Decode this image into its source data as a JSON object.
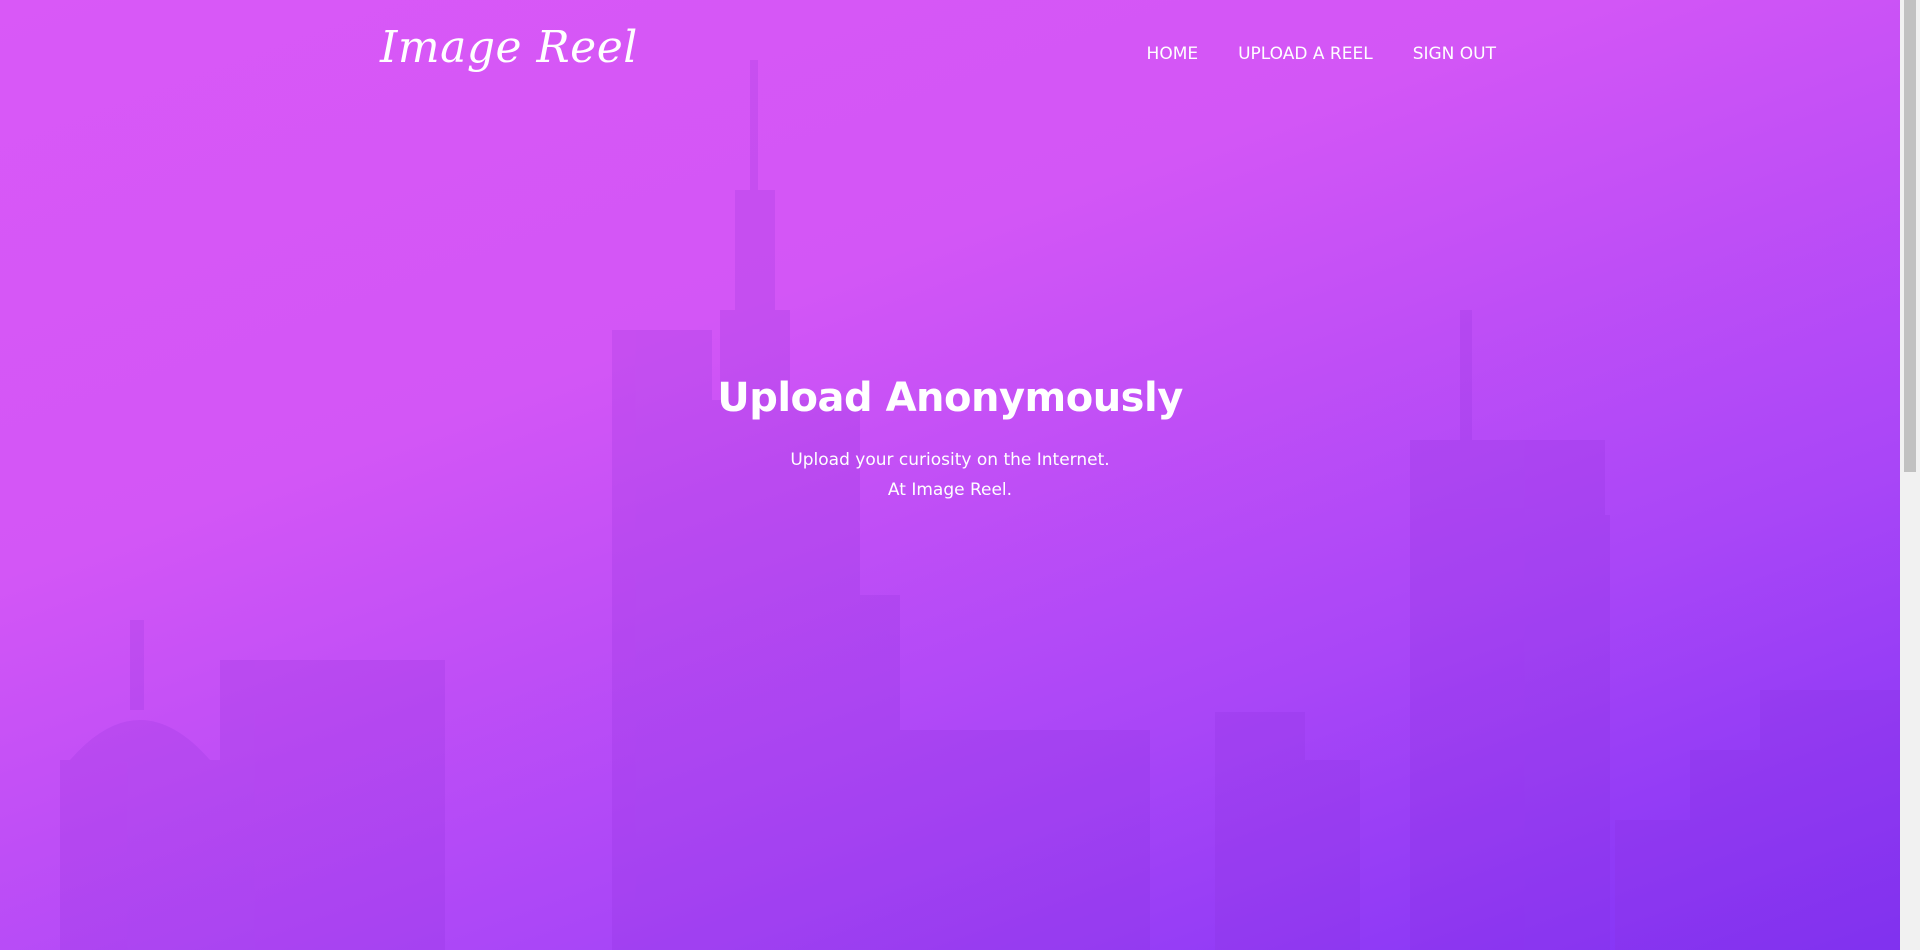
{
  "header": {
    "logo": "Image Reel",
    "nav": [
      {
        "label": "HOME"
      },
      {
        "label": "UPLOAD A REEL"
      },
      {
        "label": "SIGN OUT"
      }
    ]
  },
  "hero": {
    "title": "Upload Anonymously",
    "line1": "Upload your curiosity on the Internet.",
    "line2": "At Image Reel."
  },
  "colors": {
    "gradient_top": "#d958f7",
    "gradient_bottom": "#7e32f5",
    "text": "#ffffff"
  }
}
